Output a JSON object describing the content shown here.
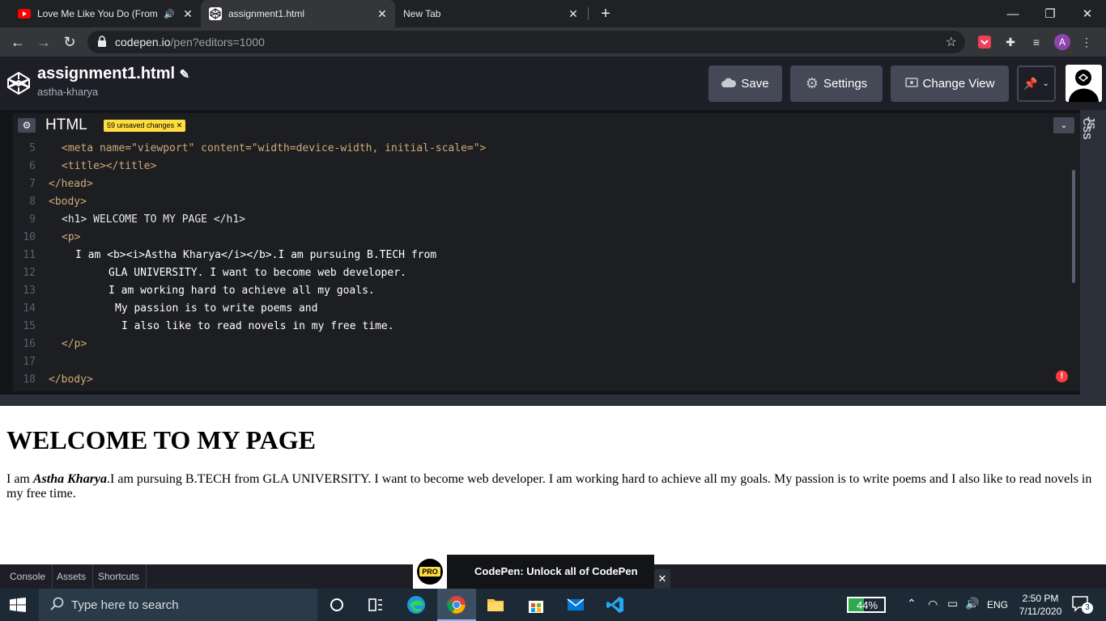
{
  "browser": {
    "tabs": [
      {
        "title": "Love Me Like You Do (From",
        "favicon": "youtube-icon",
        "audio": true
      },
      {
        "title": "assignment1.html",
        "favicon": "codepen-icon",
        "active": true
      },
      {
        "title": "New Tab"
      }
    ],
    "url_host": "codepen.io",
    "url_path": "/pen?editors=1000",
    "profile_initial": "A"
  },
  "codepen": {
    "pen_title": "assignment1.html",
    "username": "astha-kharya",
    "buttons": {
      "save": "Save",
      "settings": "Settings",
      "change_view": "Change View"
    },
    "editor_label": "HTML",
    "unsaved_badge": "59 unsaved changes",
    "side_tabs": [
      "JS",
      "CSS"
    ]
  },
  "code_lines": [
    {
      "n": "5",
      "text": "<meta name=\"viewport\" content=\"width=device-width, initial-scale=\">"
    },
    {
      "n": "6",
      "text": "<title></title>"
    },
    {
      "n": "7",
      "text": "</head>"
    },
    {
      "n": "8",
      "text": "<body>"
    },
    {
      "n": "9",
      "text": "<h1> WELCOME TO MY PAGE </h1>"
    },
    {
      "n": "10",
      "text": "<p>"
    },
    {
      "n": "11",
      "text": "I am <b><i>Astha Kharya</i></b>.I am pursuing B.TECH from"
    },
    {
      "n": "12",
      "text": "GLA UNIVERSITY. I want to become web developer."
    },
    {
      "n": "13",
      "text": "I am working hard to achieve all my goals."
    },
    {
      "n": "14",
      "text": "My passion is to write poems and"
    },
    {
      "n": "15",
      "text": "I also like to read novels in my free time."
    },
    {
      "n": "16",
      "text": "</p>"
    },
    {
      "n": "17",
      "text": ""
    },
    {
      "n": "18",
      "text": "</body>"
    }
  ],
  "preview": {
    "heading": "WELCOME TO MY PAGE",
    "para_before": "I am ",
    "para_name": "Astha Kharya",
    "para_after": ".I am pursuing B.TECH from GLA UNIVERSITY. I want to become web developer. I am working hard to achieve all my goals. My passion is to write poems and I also like to read novels in my free time."
  },
  "footer": {
    "buttons": [
      "Console",
      "Assets",
      "Shortcuts"
    ],
    "promo_badge": "PRO",
    "promo_text": "CodePen: Unlock all of CodePen"
  },
  "taskbar": {
    "search_placeholder": "Type here to search",
    "battery": "44%",
    "language": "ENG",
    "time": "2:50 PM",
    "date": "7/11/2020",
    "notification_count": "3"
  }
}
